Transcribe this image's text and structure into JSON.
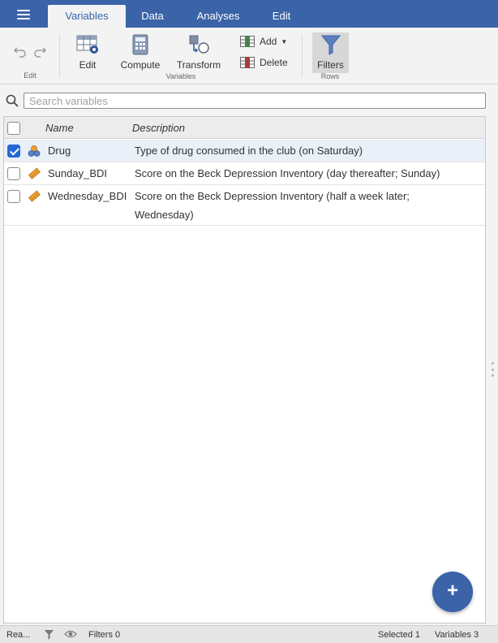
{
  "tabs": [
    {
      "label": "Variables",
      "active": true
    },
    {
      "label": "Data",
      "active": false
    },
    {
      "label": "Analyses",
      "active": false
    },
    {
      "label": "Edit",
      "active": false
    }
  ],
  "ribbon": {
    "edit_group_label": "Edit",
    "edit_label": "Edit",
    "compute_label": "Compute",
    "transform_label": "Transform",
    "add_label": "Add",
    "delete_label": "Delete",
    "variables_group_label": "Variables",
    "filters_label": "Filters",
    "rows_group_label": "Rows"
  },
  "search": {
    "placeholder": "Search variables",
    "value": ""
  },
  "table": {
    "headers": {
      "name": "Name",
      "description": "Description"
    },
    "rows": [
      {
        "name": "Drug",
        "description": "Type of drug consumed in the club (on Saturday)",
        "type_icon": "nominal-icon",
        "checked": true
      },
      {
        "name": "Sunday_BDI",
        "description": "Score on the Beck Depression Inventory (day thereafter; Sunday)",
        "type_icon": "continuous-icon",
        "checked": false
      },
      {
        "name": "Wednesday_BDI",
        "description": "Score on the Beck Depression Inventory (half a week later; Wednesday)",
        "type_icon": "continuous-icon",
        "checked": false
      }
    ]
  },
  "fab": {
    "label": "+"
  },
  "status": {
    "ready": "Rea...",
    "filters": "Filters 0",
    "selected": "Selected 1",
    "variables": "Variables 3"
  },
  "colors": {
    "accent": "#3a63a8",
    "checkbox": "#2469d6",
    "selected_row": "#eaf0f8"
  }
}
